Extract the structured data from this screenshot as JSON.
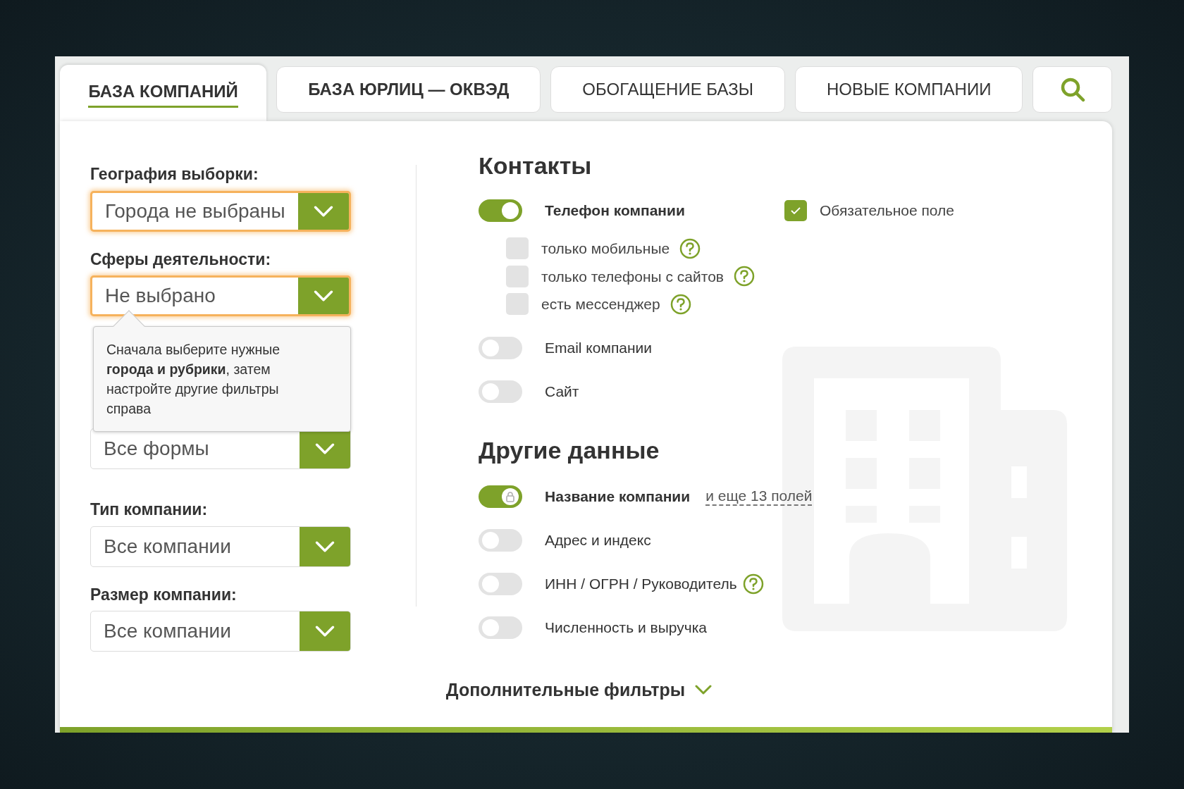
{
  "tabs": [
    {
      "label": "БАЗА КОМПАНИЙ",
      "selected": true
    },
    {
      "label": "БАЗА ЮРЛИЦ — ОКВЭД",
      "selected": false
    },
    {
      "label": "ОБОГАЩЕНИЕ БАЗЫ",
      "selected": false
    },
    {
      "label": "НОВЫЕ КОМПАНИИ",
      "selected": false
    }
  ],
  "filters": [
    {
      "label": "География выборки:",
      "value": "Города не выбраны",
      "highlighted": true
    },
    {
      "label": "Сферы деятельности:",
      "value": "Не выбрано",
      "highlighted": true
    },
    {
      "value": "Все формы",
      "highlighted": false
    },
    {
      "label": "Тип компании:",
      "value": "Все компании",
      "highlighted": false
    },
    {
      "label": "Размер компании:",
      "value": "Все компании",
      "highlighted": false
    }
  ],
  "tooltip": {
    "text": "Сначала выберите нужные **города и рубрики**, затем настройте другие фильтры справа"
  },
  "contacts": {
    "title": "Контакты",
    "items": [
      {
        "label": "Телефон компании",
        "on": true,
        "required": {
          "label": "Обязательное поле",
          "checked": true
        },
        "options": [
          {
            "label": "только мобильные",
            "checked": false
          },
          {
            "label": "только телефоны с сайтов",
            "checked": false
          },
          {
            "label": "есть мессенджер",
            "checked": false
          }
        ]
      },
      {
        "label": "Email компании",
        "on": false
      },
      {
        "label": "Сайт",
        "on": false
      }
    ]
  },
  "other": {
    "title": "Другие данные",
    "items": [
      {
        "label": "Название компании",
        "on": true,
        "locked": true,
        "help": false,
        "more": "и еще 13 полей"
      },
      {
        "label": "Адрес и индекс",
        "on": false,
        "locked": false,
        "help": false
      },
      {
        "label": "ИНН / ОГРН / Руководитель",
        "on": false,
        "locked": false,
        "help": true
      },
      {
        "label": "Численность и выручка",
        "on": false,
        "locked": false,
        "help": false
      }
    ]
  },
  "more_filters": "Дополнительные фильтры"
}
